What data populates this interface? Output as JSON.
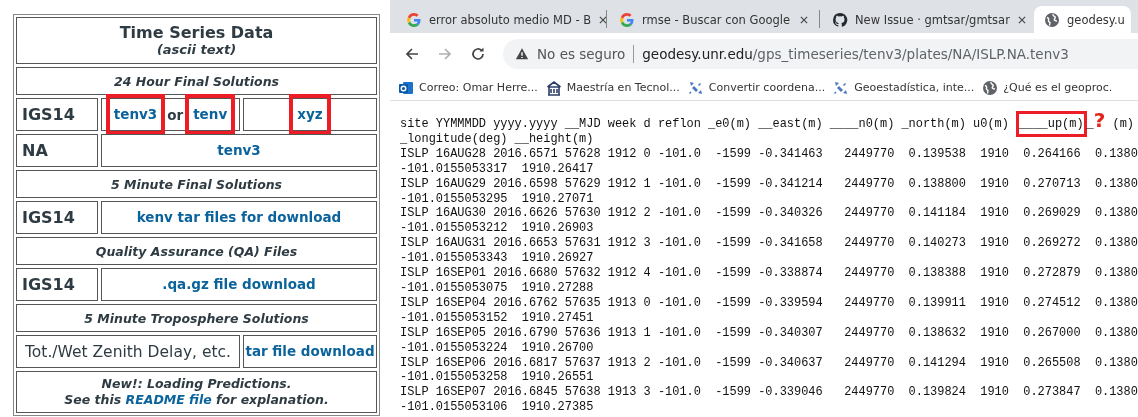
{
  "left_panel": {
    "rows": [
      {
        "kind": "title",
        "title": "Time Series Data",
        "subtitle": "(ascii text)"
      },
      {
        "kind": "heading",
        "text": "24 Hour Final Solutions"
      },
      {
        "kind": "data",
        "label": "IGS14",
        "cells": [
          [
            {
              "kind": "link",
              "text": "tenv3",
              "boxed": true
            },
            {
              "kind": "text",
              "text": "or"
            },
            {
              "kind": "link",
              "text": "tenv",
              "boxed": true
            }
          ],
          [
            {
              "kind": "link",
              "text": "xyz",
              "boxed": true
            }
          ]
        ]
      },
      {
        "kind": "data",
        "label": "NA",
        "cells": [
          [
            {
              "kind": "link",
              "text": "tenv3",
              "boxed": false
            }
          ]
        ]
      },
      {
        "kind": "heading",
        "text": "5 Minute Final Solutions"
      },
      {
        "kind": "data",
        "label": "IGS14",
        "cells": [
          [
            {
              "kind": "link",
              "text": "kenv tar files for download",
              "boxed": false
            }
          ]
        ]
      },
      {
        "kind": "heading",
        "text": "Quality Assurance (QA) Files"
      },
      {
        "kind": "data",
        "label": "IGS14",
        "cells": [
          [
            {
              "kind": "link",
              "text": ".qa.gz file download",
              "boxed": false
            }
          ]
        ]
      },
      {
        "kind": "heading",
        "text": "5 Minute Troposphere Solutions"
      },
      {
        "kind": "wide_label",
        "label": "Tot./Wet Zenith Delay, etc.",
        "cells": [
          [
            {
              "kind": "link",
              "text": "tar file download",
              "boxed": false
            }
          ]
        ]
      },
      {
        "kind": "note",
        "line1": "New!: Loading Predictions.",
        "before": "See this",
        "link": "README file",
        "after": "for explanation."
      }
    ]
  },
  "browser": {
    "tabs": [
      {
        "kind": "google",
        "title": "error absoluto medio MD - B",
        "selected": false
      },
      {
        "kind": "google",
        "title": "rmse - Buscar con Google",
        "selected": false
      },
      {
        "kind": "github",
        "title": "New Issue · gmtsar/gmtsar",
        "selected": false
      },
      {
        "kind": "site",
        "title": "geodesy.u",
        "selected": true
      }
    ],
    "forward_enabled": false,
    "security": "No es seguro",
    "url_host": "geodesy.unr.edu",
    "url_path": "/gps_timeseries/tenv3/plates/NA/ISLP.NA.tenv3",
    "bookmarks": [
      {
        "kind": "mail",
        "label": "Correo: Omar Herre..."
      },
      {
        "kind": "building",
        "label": "Maestría en Tecnol..."
      },
      {
        "kind": "satellite",
        "label": "Convertir coordena..."
      },
      {
        "kind": "satellite",
        "label": "Geoestadística, inte..."
      },
      {
        "kind": "site",
        "label": "¿Qué es el geoproc."
      }
    ]
  },
  "document": {
    "header_before": "site YYMMMDD yyyy.yyyy __MJD week d reflon _e0(m) __east(m) ____n0(m) _north(m) u0(m) ",
    "header_boxed": "____up(m)",
    "header_after": "_",
    "question_mark": "?",
    "header_end": " (m)",
    "header_line2": "_longitude(deg) __height(m)",
    "lines": [
      "ISLP 16AUG28 2016.6571 57628 1912 0 -101.0  -1599 -0.341463   2449770  0.139538  1910  0.264166  0.1380",
      "-101.0155053317  1910.26417",
      "ISLP 16AUG29 2016.6598 57629 1912 1 -101.0  -1599 -0.341214   2449770  0.138800  1910  0.270713  0.1380",
      "-101.0155053295  1910.27071",
      "ISLP 16AUG30 2016.6626 57630 1912 2 -101.0  -1599 -0.340326   2449770  0.141184  1910  0.269029  0.1380",
      "-101.0155053212  1910.26903",
      "ISLP 16AUG31 2016.6653 57631 1912 3 -101.0  -1599 -0.341658   2449770  0.140273  1910  0.269272  0.1380",
      "-101.0155053343  1910.26927",
      "ISLP 16SEP01 2016.6680 57632 1912 4 -101.0  -1599 -0.338874   2449770  0.138388  1910  0.272879  0.1380",
      "-101.0155053075  1910.27288",
      "ISLP 16SEP04 2016.6762 57635 1913 0 -101.0  -1599 -0.339594   2449770  0.139911  1910  0.274512  0.1380",
      "-101.0155053152  1910.27451",
      "ISLP 16SEP05 2016.6790 57636 1913 1 -101.0  -1599 -0.340307   2449770  0.138632  1910  0.267000  0.1380",
      "-101.0155053224  1910.26700",
      "ISLP 16SEP06 2016.6817 57637 1913 2 -101.0  -1599 -0.340637   2449770  0.141294  1910  0.265508  0.1380",
      "-101.0155053258  1910.26551",
      "ISLP 16SEP07 2016.6845 57638 1913 3 -101.0  -1599 -0.339046   2449770  0.139824  1910  0.273847  0.1380",
      "-101.0155053106  1910.27385"
    ]
  }
}
